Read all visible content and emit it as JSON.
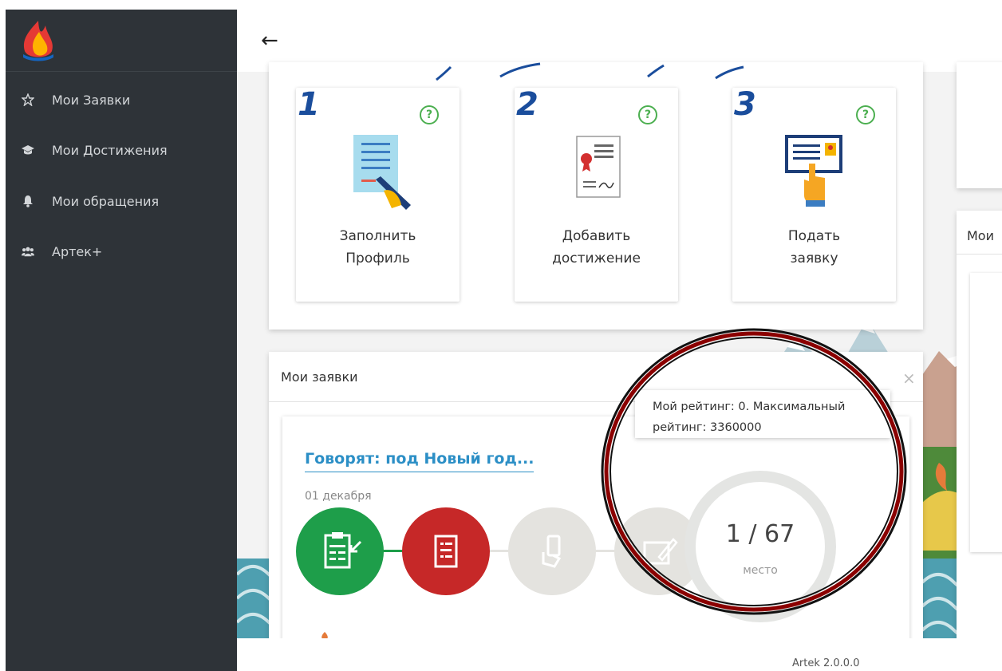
{
  "sidebar": {
    "items": [
      {
        "label": "Мои Заявки",
        "icon": "star-icon"
      },
      {
        "label": "Мои Достижения",
        "icon": "graduation-cap-icon"
      },
      {
        "label": "Мои обращения",
        "icon": "bell-icon"
      },
      {
        "label": "Артек+",
        "icon": "users-icon"
      }
    ]
  },
  "header": {
    "back_label": "←"
  },
  "steps": [
    {
      "number": "1",
      "line1": "Заполнить",
      "line2": "Профиль",
      "help": "?"
    },
    {
      "number": "2",
      "line1": "Добавить",
      "line2": "достижение",
      "help": "?"
    },
    {
      "number": "3",
      "line1": "Подать",
      "line2": "заявку",
      "help": "?"
    }
  ],
  "right_panel": {
    "title_fragment": "Мои"
  },
  "applications_panel": {
    "title": "Мои заявки",
    "close": "×",
    "application": {
      "title": "Говорят: под Новый год...",
      "date": "01 декабря"
    },
    "tooltip": {
      "line1": "Мой рейтинг: 0. Максимальный",
      "line2": "рейтинг: 3360000"
    },
    "rank": {
      "value": "1 / 67",
      "label": "место"
    }
  },
  "footer": {
    "version": "Artek 2.0.0.0"
  },
  "colors": {
    "sidebar_bg": "#2e3338",
    "link": "#2c8fc6",
    "stage_done": "#1e9e4a",
    "stage_active": "#c62828",
    "stage_pending": "#e4e3df",
    "annotation": "#8b0000"
  }
}
